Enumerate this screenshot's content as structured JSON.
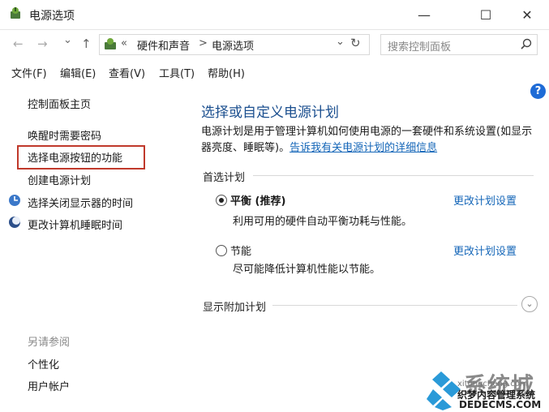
{
  "window": {
    "title": "电源选项",
    "minimize": "—",
    "maximize": "☐",
    "close": "✕"
  },
  "nav": {
    "back": "←",
    "forward": "→",
    "dropdown": "⌄",
    "up": "↑",
    "breadcrumb_sep1": "«",
    "breadcrumb_1": "硬件和声音",
    "breadcrumb_sep2": ">",
    "breadcrumb_2": "电源选项",
    "addr_dropdown": "⌄",
    "refresh": "↻",
    "search_placeholder": "搜索控制面板"
  },
  "menu": {
    "file": "文件(F)",
    "edit": "编辑(E)",
    "view": "查看(V)",
    "tools": "工具(T)",
    "help": "帮助(H)"
  },
  "help_button": "?",
  "sidebar": {
    "home": "控制面板主页",
    "links": [
      "唤醒时需要密码",
      "选择电源按钮的功能",
      "创建电源计划",
      "选择关闭显示器的时间",
      "更改计算机睡眠时间"
    ],
    "see_also_title": "另请参阅",
    "see_also": [
      "个性化",
      "用户帐户"
    ]
  },
  "main": {
    "title": "选择或自定义电源计划",
    "desc_line1": "电源计划是用于管理计算机如何使用电源的一套硬件和系统设置(如显示",
    "desc_line2_prefix": "器亮度、睡眠等)。",
    "desc_link": "告诉我有关电源计划的详细信息",
    "preferred_label": "首选计划",
    "plans": [
      {
        "name": "平衡 (推荐)",
        "desc": "利用可用的硬件自动平衡功耗与性能。",
        "link": "更改计划设置",
        "selected": true
      },
      {
        "name": "节能",
        "desc": "尽可能降低计算机性能以节能。",
        "link": "更改计划设置",
        "selected": false
      }
    ],
    "additional_label": "显示附加计划",
    "expand": "⌄"
  },
  "watermark": {
    "big": "系统城",
    "url": "xitongcheng.com",
    "cn": "织梦内容管理系统",
    "dede": "DEDECMS.COM"
  },
  "colors": {
    "link": "#1466b8",
    "title": "#1b4f8f",
    "highlight": "#c0392b",
    "help_bg": "#1e6bd6"
  }
}
